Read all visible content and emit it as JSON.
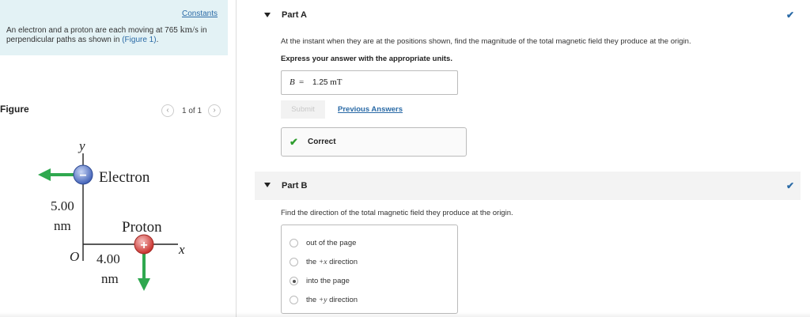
{
  "problem": {
    "constants_label": "Constants",
    "text_before": "An electron and a proton are each moving at 765",
    "speed_unit": "km/s",
    "text_after": "in perpendicular paths as shown in",
    "figure_link": "(Figure 1)",
    "text_end": "."
  },
  "figure": {
    "label": "Figure",
    "pager_text": "1 of 1",
    "prev_icon": "chevron-left-icon",
    "next_icon": "chevron-right-icon",
    "axis_y_label": "y",
    "axis_x_label": "x",
    "origin_label": "O",
    "electron_label": "Electron",
    "proton_label": "Proton",
    "dist_y_value": "5.00",
    "dist_y_unit": "nm",
    "dist_x_value": "4.00",
    "dist_x_unit": "nm",
    "electron_sign": "−",
    "proton_sign": "+",
    "colors": {
      "arrow": "#2fa84f",
      "electron": "#5b79c7",
      "proton": "#d9534f"
    }
  },
  "part_a": {
    "title": "Part A",
    "question": "At the instant when they are at the positions shown, find the magnitude of the total magnetic field they produce at the origin.",
    "instruction": "Express your answer with the appropriate units.",
    "answer_label": "B",
    "answer_eq": "=",
    "answer_value": "1.25",
    "answer_unit": "mT",
    "submit_label": "Submit",
    "previous_answers_label": "Previous Answers",
    "feedback": "Correct",
    "status_icon": "checkmark-icon"
  },
  "part_b": {
    "title": "Part B",
    "question": "Find the direction of the total magnetic field they produce at the origin.",
    "options": [
      {
        "pre": "out of the page",
        "math": "",
        "post": ""
      },
      {
        "pre": "the ",
        "math": "+x",
        "post": " direction"
      },
      {
        "pre": "into the page",
        "math": "",
        "post": ""
      },
      {
        "pre": "the ",
        "math": "+y",
        "post": " direction"
      }
    ],
    "selected_option": "into the page",
    "status_icon": "checkmark-icon"
  }
}
